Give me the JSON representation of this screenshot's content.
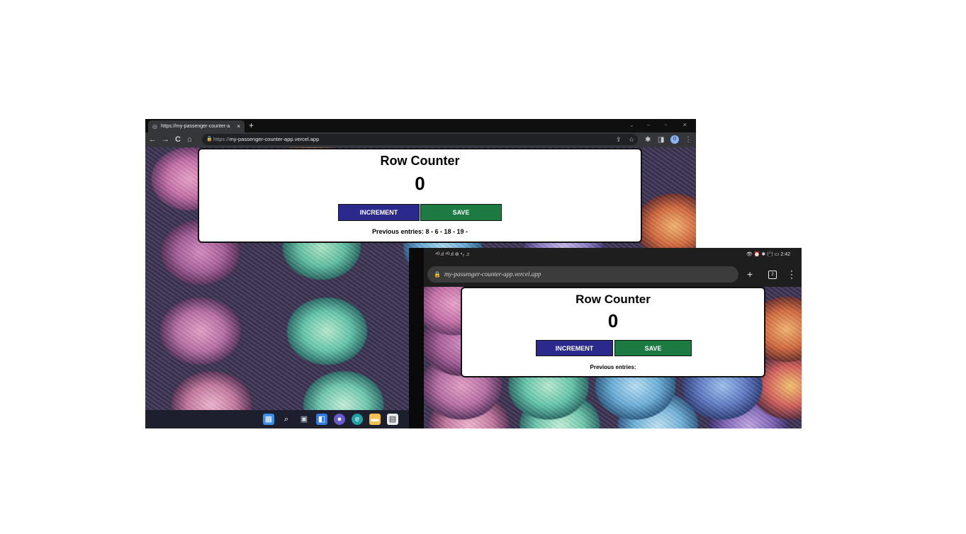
{
  "desktop": {
    "tab": {
      "favicon": "globe-icon",
      "title": "https://my-passenger-counter-a",
      "close": "×"
    },
    "new_tab": "+",
    "window_controls": {
      "chevron": "⌄",
      "minimize": "–",
      "restore": "▫",
      "close": "✕"
    },
    "nav": {
      "back": "←",
      "forward": "→",
      "reload": "C",
      "home": "⌂"
    },
    "omnibox": {
      "lock": "🔒",
      "scheme": "https://",
      "host": "my-passenger-counter-app.vercel.app",
      "share": "⇪",
      "star": "☆"
    },
    "toolbar_right": {
      "extensions": "✱",
      "sidepanel": "◨",
      "profile": "0",
      "menu": "⋮"
    },
    "app": {
      "title": "Row Counter",
      "count": "0",
      "increment_label": "INCREMENT",
      "save_label": "SAVE",
      "previous_entries": "Previous entries: 8 - 6 - 18 - 19 -"
    },
    "taskbar_icons": [
      "windows-icon",
      "search-icon",
      "task-view-icon",
      "widgets-icon",
      "chat-icon",
      "edge-icon",
      "file-explorer-icon",
      "store-icon"
    ]
  },
  "mobile": {
    "status": {
      "left": "⁴ᴳ.ıl ⁴ᴳ.ıl ⊚ ⁴₂ ♫",
      "right": "👁 ⏰ ✱ 📳 ▭ 2:42"
    },
    "omnibox": {
      "lock": "🔒",
      "url": "my-passenger-counter-app.vercel.app"
    },
    "toolbar": {
      "new_tab": "+",
      "tabs_count": "2",
      "menu": "⋮"
    },
    "app": {
      "title": "Row Counter",
      "count": "0",
      "increment_label": "INCREMENT",
      "save_label": "SAVE",
      "previous_entries": "Previous entries:"
    }
  },
  "colors": {
    "increment": "#2b2a8c",
    "save": "#1d7a43"
  }
}
